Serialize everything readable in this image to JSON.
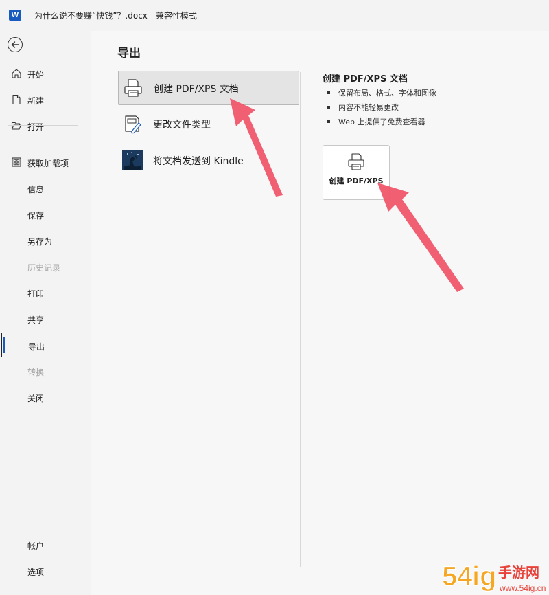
{
  "titlebar": {
    "app_icon_letter": "W",
    "title": "为什么说不要赚“快钱”？.docx  -  兼容性模式"
  },
  "sidebar": {
    "items": [
      {
        "label": "开始",
        "icon": "home-icon"
      },
      {
        "label": "新建",
        "icon": "new-document-icon"
      },
      {
        "label": "打开",
        "icon": "folder-open-icon"
      },
      {
        "label": "获取加载项",
        "icon": "grid-icon"
      },
      {
        "label": "信息"
      },
      {
        "label": "保存"
      },
      {
        "label": "另存为"
      },
      {
        "label": "历史记录"
      },
      {
        "label": "打印"
      },
      {
        "label": "共享"
      },
      {
        "label": "导出"
      },
      {
        "label": "转换"
      },
      {
        "label": "关闭"
      }
    ],
    "bottom": [
      {
        "label": "帐户"
      },
      {
        "label": "选项"
      }
    ]
  },
  "main": {
    "title": "导出",
    "options": [
      {
        "label": "创建 PDF/XPS 文档",
        "icon": "printer-document-icon"
      },
      {
        "label": "更改文件类型",
        "icon": "change-file-type-icon"
      },
      {
        "label": "将文档发送到 Kindle",
        "icon": "kindle-icon"
      }
    ],
    "detail": {
      "title": "创建 PDF/XPS 文档",
      "bullets": [
        "保留布局、格式、字体和图像",
        "内容不能轻易更改",
        "Web 上提供了免费查看器"
      ],
      "button_label": "创建 PDF/XPS"
    }
  },
  "watermark": {
    "text": "54ig手游网",
    "url_text": "www.54ig.cn"
  },
  "colors": {
    "accent": "#185abd",
    "arrow": "#f0566a"
  }
}
